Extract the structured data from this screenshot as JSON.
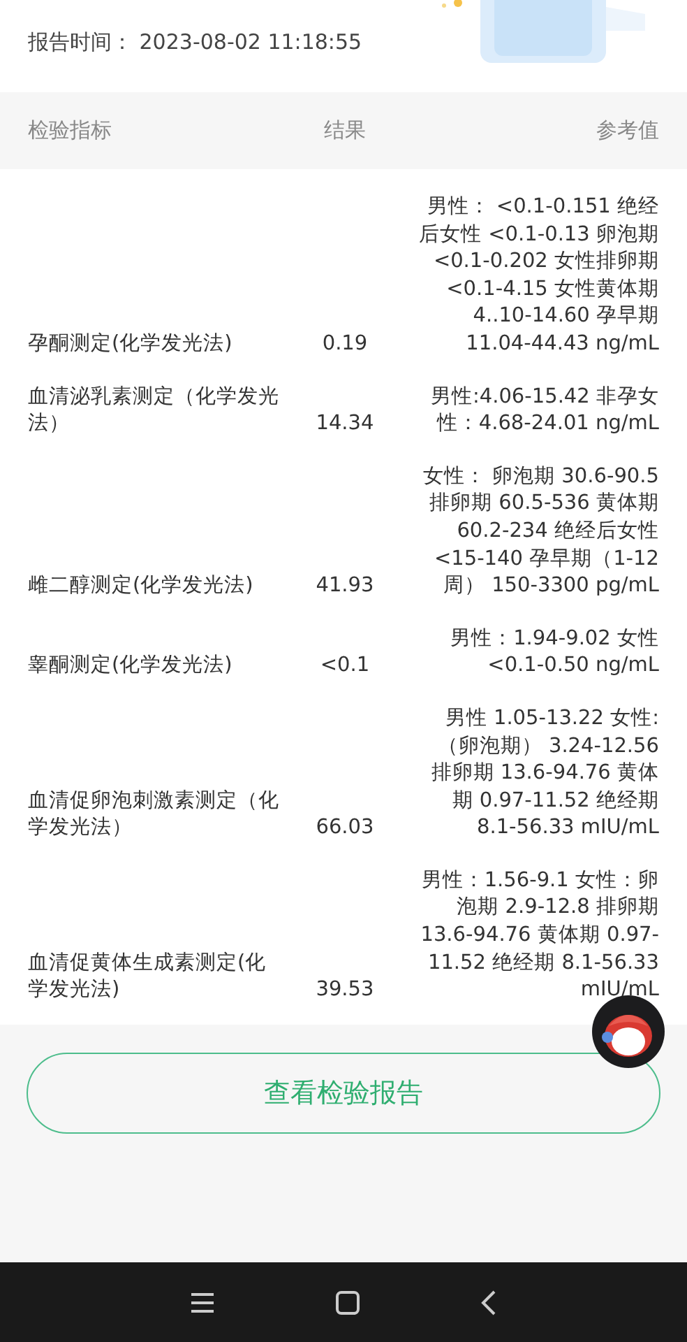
{
  "report_time": {
    "label": "报告时间：",
    "value": "2023-08-02 11:18:55"
  },
  "table": {
    "columns": [
      "检验指标",
      "结果",
      "参考值"
    ],
    "rows": [
      {
        "name": "孕酮测定(化学发光法)",
        "result": "0.19",
        "reference": "男性： <0.1-0.151 绝经后女性 <0.1-0.13 卵泡期 <0.1-0.202 女性排卵期 <0.1-4.15 女性黄体期 4..10-14.60 孕早期 11.04-44.43 ng/mL"
      },
      {
        "name": "血清泌乳素测定（化学发光法）",
        "result": "14.34",
        "reference": "男性:4.06-15.42 非孕女性：4.68-24.01 ng/mL"
      },
      {
        "name": "雌二醇测定(化学发光法)",
        "result": "41.93",
        "reference": "女性： 卵泡期 30.6-90.5 排卵期 60.5-536 黄体期 60.2-234 绝经后女性 <15-140 孕早期（1-12周） 150-3300 pg/mL"
      },
      {
        "name": "睾酮测定(化学发光法)",
        "result": "<0.1",
        "reference": "男性：1.94-9.02 女性 <0.1-0.50 ng/mL"
      },
      {
        "name": "血清促卵泡刺激素测定（化学发光法）",
        "result": "66.03",
        "reference": "男性 1.05-13.22 女性:（卵泡期） 3.24-12.56 排卵期 13.6-94.76 黄体期 0.97-11.52 绝经期 8.1-56.33 mIU/mL"
      },
      {
        "name": "血清促黄体生成素测定(化学发光法)",
        "result": "39.53",
        "reference": "男性：1.56-9.1 女性：卵泡期 2.9-12.8 排卵期 13.6-94.76 黄体期 0.97-11.52 绝经期 8.1-56.33 mIU/mL"
      }
    ]
  },
  "button": "查看检验报告"
}
